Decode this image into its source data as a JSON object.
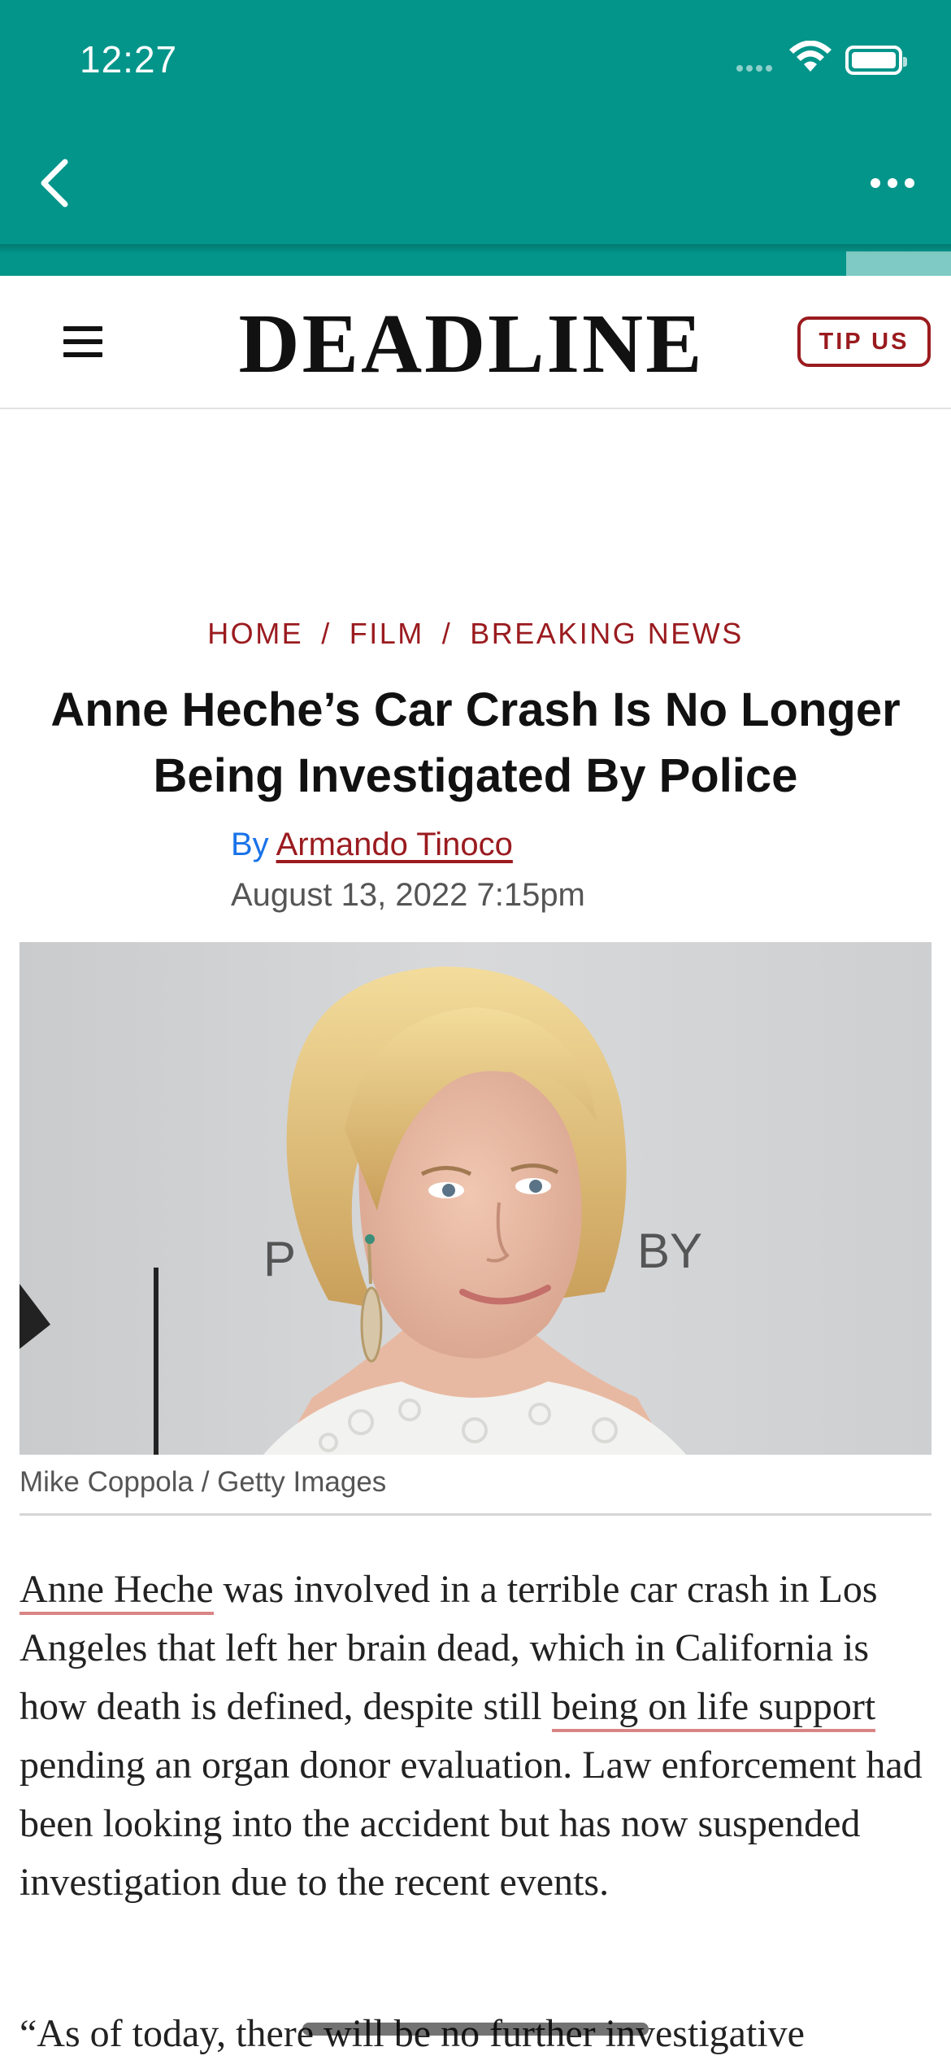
{
  "status_bar": {
    "time": "12:27"
  },
  "app_bar": {
    "back_icon": "chevron-left-icon",
    "more_icon": "more-horizontal-icon",
    "read_progress": 0.89,
    "colors": {
      "accent": "#03958a",
      "progress_track": "#7fcac4"
    }
  },
  "site_header": {
    "logo": "DEADLINE",
    "tip_label": "TIP US",
    "menu_icon": "hamburger-icon",
    "brand_color": "#9a1b1f"
  },
  "breadcrumb": {
    "items": [
      "HOME",
      "FILM",
      "BREAKING NEWS"
    ],
    "separator": "/"
  },
  "article": {
    "headline": "Anne Heche’s Car Crash Is No Longer Being Investigated By Police",
    "byline_prefix": "By",
    "author": "Armando Tinoco",
    "date": "August 13, 2022 7:15pm",
    "image_caption": "Mike Coppola / Getty Images",
    "paragraph1": {
      "link1": "Anne Heche",
      "text1": " was involved in a terrible car crash in Los Angeles that left her brain dead, which in California is how death is defined, despite still ",
      "link2": "being on life support",
      "text2": " pending an organ donor evaluation. Law enforcement had been looking into the accident but has now suspended investigation due to the recent events."
    },
    "paragraph2": "“As of today, there will be no further investigative"
  }
}
